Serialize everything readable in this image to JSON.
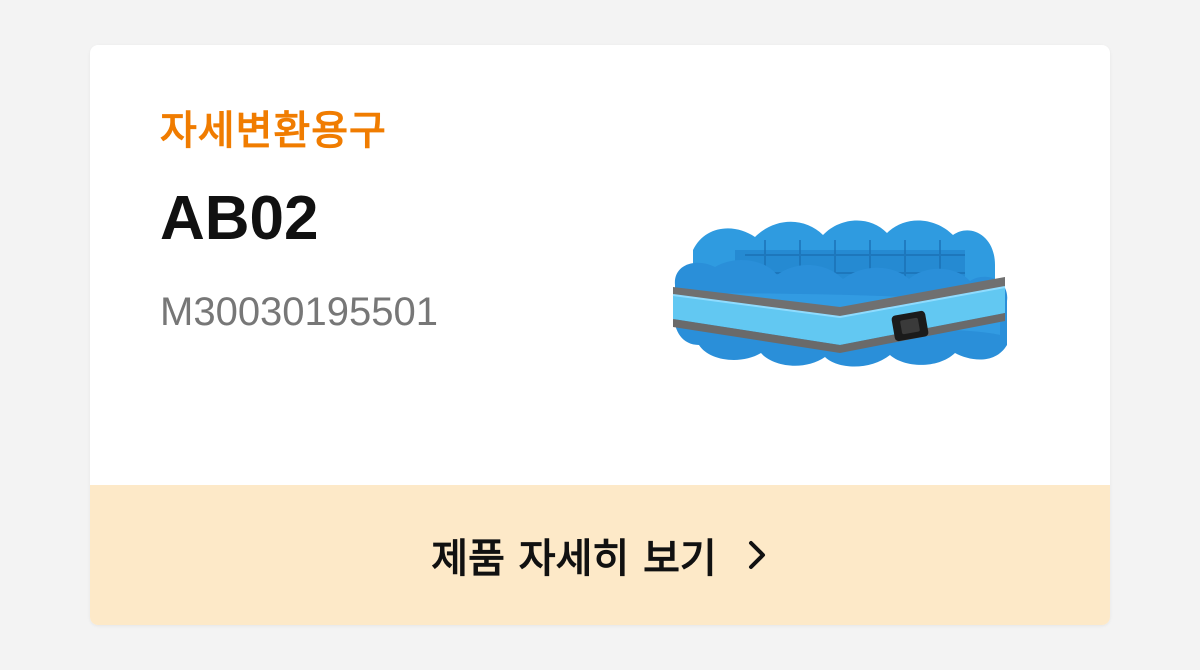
{
  "product": {
    "category": "자세변환용구",
    "model": "AB02",
    "code": "M30030195501",
    "image_icon": "positioning-cushion-belt-icon"
  },
  "cta": {
    "label": "제품 자세히 보기",
    "icon": "chevron-right-icon"
  },
  "colors": {
    "accent": "#f07c00",
    "cta_background": "#fde9c8",
    "page_background": "#f3f3f3",
    "product_blue": "#2f9be0",
    "strap_blue": "#62c8f2",
    "strap_gray": "#707070"
  }
}
